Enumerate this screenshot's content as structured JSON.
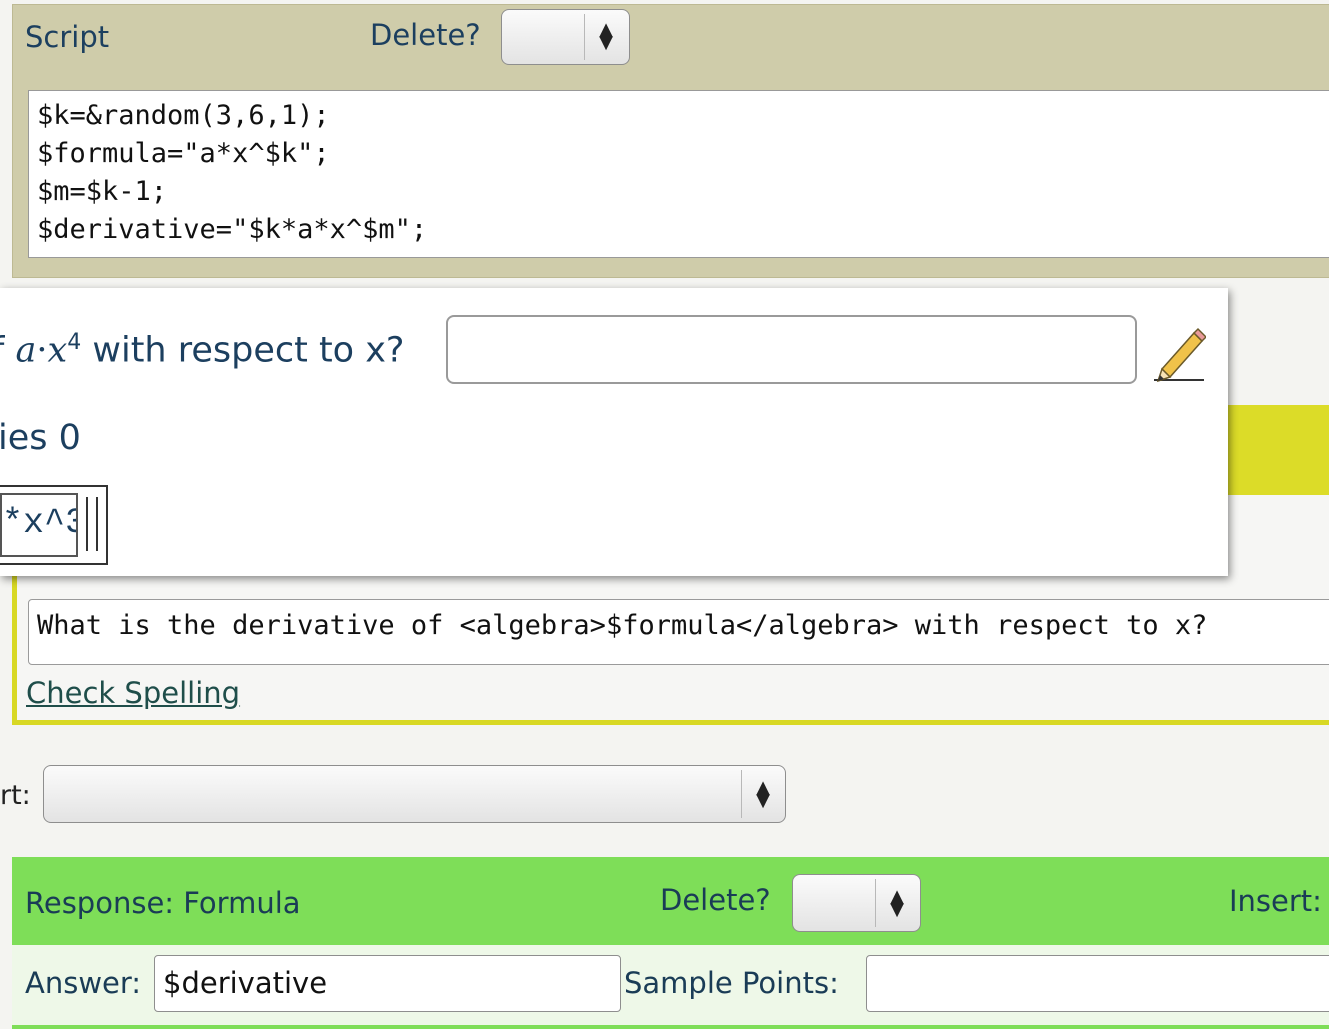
{
  "script": {
    "title": "Script",
    "delete_label": "Delete?",
    "code_lines": [
      "$k=&random(3,6,1);",
      "$formula=\"a*x^$k\";",
      "$m=$k-1;",
      "$derivative=\"$k*a*x^$m\";"
    ]
  },
  "preview": {
    "question_prefix": "f ",
    "question_var_a": "a",
    "question_dot": "·",
    "question_var_x": "x",
    "question_exponent": "4",
    "question_suffix": " with respect to x?",
    "tries_text": "ies 0",
    "answer_fragment": "*x^3",
    "edit_icon": "pencil-icon"
  },
  "text_block": {
    "source": "What is the derivative of <algebra>$formula</algebra> with respect to x?",
    "check_spelling_label": "Check Spelling"
  },
  "insert_row": {
    "label": "rt:",
    "selected": ""
  },
  "response": {
    "title": "Response: Formula",
    "delete_label": "Delete?",
    "insert_label": "Insert:",
    "answer_label": "Answer:",
    "answer_value": "$derivative",
    "sample_points_label": "Sample Points:",
    "sample_points_value": ""
  },
  "colors": {
    "script_bg": "#cfccaa",
    "text_border": "#d8d824",
    "response_bg": "#7ede58",
    "label_text": "#1c3f5f"
  }
}
